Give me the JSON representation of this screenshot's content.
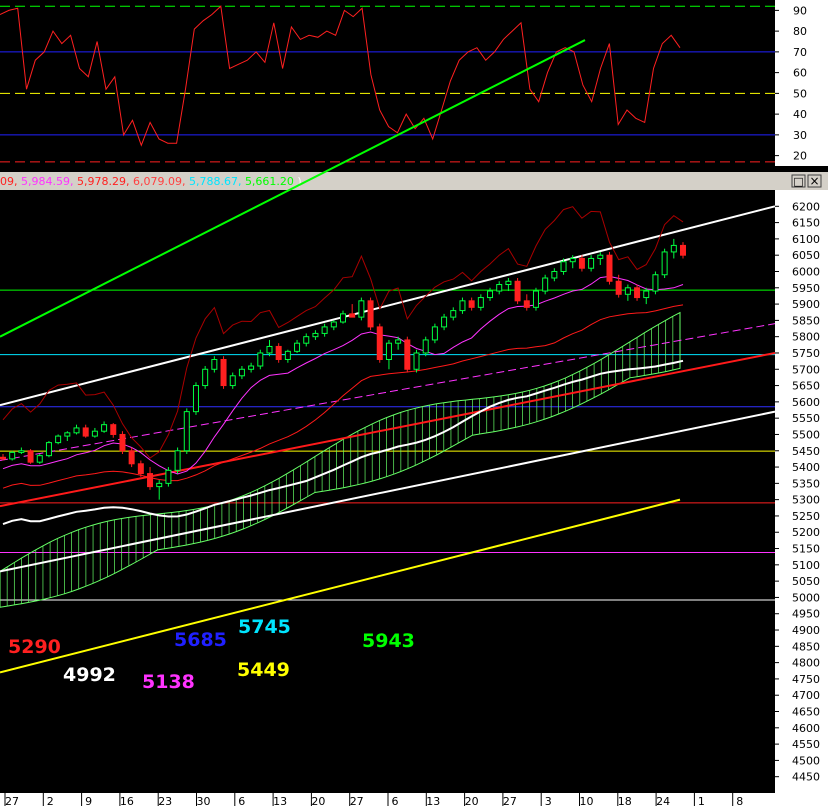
{
  "colors": {
    "background": "#000000",
    "axis_panel": "#ffffff",
    "title_bar": "#d4d0c8",
    "rsi": "#ff2020",
    "price_up": "#00ff40",
    "price_down": "#ff2020",
    "white_line": "#ffffff",
    "green_line": "#00ff00",
    "red_line": "#ff1a1a",
    "yellow_line": "#ffff00",
    "magenta_line": "#ff33ff",
    "cloud": "#66ff66"
  },
  "legend": {
    "values": [
      {
        "text": "09,",
        "color": "#ff2020"
      },
      {
        "text": "5,984.59,",
        "color": "#ff33ff"
      },
      {
        "text": "5,978.29,",
        "color": "#ff2020"
      },
      {
        "text": "6,079.09,",
        "color": "#ff4040"
      },
      {
        "text": "5,788.67,",
        "color": "#00e5ff"
      },
      {
        "text": "5,661.20",
        "color": "#00ff00"
      },
      {
        "text": ")",
        "color": "#ffffff"
      }
    ]
  },
  "window_buttons": {
    "restore": "□",
    "close": "×"
  },
  "chart_data": [
    {
      "type": "line",
      "panel": "rsi",
      "yticks": [
        20,
        30,
        40,
        50,
        60,
        70,
        80,
        90
      ],
      "ylim": [
        15,
        95
      ],
      "reference_lines": [
        {
          "value": 92,
          "color": "#00ff00",
          "style": "dashed"
        },
        {
          "value": 70,
          "color": "#2020ff",
          "style": "solid"
        },
        {
          "value": 50,
          "color": "#ffff00",
          "style": "dashed"
        },
        {
          "value": 30,
          "color": "#2020ff",
          "style": "solid"
        },
        {
          "value": 17,
          "color": "#ff2020",
          "style": "dashed"
        }
      ],
      "series": [
        {
          "values": [
            88,
            90,
            91,
            52,
            66,
            70,
            80,
            74,
            78,
            62,
            58,
            75,
            52,
            58,
            30,
            37,
            25,
            36,
            28,
            26,
            26,
            52,
            81,
            85,
            88,
            92,
            62,
            64,
            66,
            70,
            65,
            84,
            62,
            82,
            76,
            78,
            77,
            80,
            78,
            90,
            87,
            91,
            59,
            42,
            34,
            31,
            40,
            33,
            38,
            28,
            42,
            56,
            66,
            70,
            72,
            66,
            70,
            76,
            80,
            84,
            52,
            46,
            60,
            70,
            72,
            70,
            54,
            46,
            62,
            74,
            35,
            42,
            38,
            36,
            62,
            74,
            78,
            72
          ]
        }
      ]
    },
    {
      "type": "candlestick",
      "panel": "price",
      "x_tick_labels": [
        "27",
        "2",
        "9",
        "16",
        "23",
        "30",
        "6",
        "13",
        "20",
        "27",
        "6",
        "13",
        "20",
        "27",
        "3",
        "10",
        "18",
        "24",
        "1",
        "8"
      ],
      "yticks": [
        4450,
        4500,
        4550,
        4600,
        4650,
        4700,
        4750,
        4800,
        4850,
        4900,
        4950,
        5000,
        5050,
        5100,
        5150,
        5200,
        5250,
        5300,
        5350,
        5400,
        5450,
        5500,
        5550,
        5600,
        5650,
        5700,
        5750,
        5800,
        5850,
        5900,
        5950,
        6000,
        6050,
        6100,
        6150,
        6200
      ],
      "ylim": [
        4400,
        6250
      ],
      "horizontal_levels": [
        {
          "value": 5943,
          "color": "#00ff00"
        },
        {
          "value": 5745,
          "color": "#00e5ff"
        },
        {
          "value": 5585,
          "color": "#3030ff"
        },
        {
          "value": 5449,
          "color": "#ffff00"
        },
        {
          "value": 5290,
          "color": "#ff2020"
        },
        {
          "value": 5138,
          "color": "#ff33ff"
        },
        {
          "value": 4992,
          "color": "#ffffff"
        }
      ],
      "level_labels": [
        {
          "text": "5290",
          "color": "#ff2020"
        },
        {
          "text": "4992",
          "color": "#ffffff"
        },
        {
          "text": "5685",
          "color": "#2020ff"
        },
        {
          "text": "5138",
          "color": "#ff33ff"
        },
        {
          "text": "5745",
          "color": "#00e5ff"
        },
        {
          "text": "5449",
          "color": "#ffff00"
        },
        {
          "text": "5943",
          "color": "#00ff00"
        }
      ],
      "candles": [
        [
          5430,
          5440,
          5420,
          5425
        ],
        [
          5425,
          5450,
          5420,
          5445
        ],
        [
          5445,
          5460,
          5440,
          5450
        ],
        [
          5450,
          5455,
          5410,
          5415
        ],
        [
          5415,
          5440,
          5410,
          5435
        ],
        [
          5435,
          5480,
          5430,
          5475
        ],
        [
          5475,
          5500,
          5470,
          5495
        ],
        [
          5495,
          5510,
          5480,
          5505
        ],
        [
          5505,
          5530,
          5500,
          5520
        ],
        [
          5520,
          5530,
          5490,
          5495
        ],
        [
          5495,
          5520,
          5490,
          5510
        ],
        [
          5510,
          5540,
          5505,
          5530
        ],
        [
          5530,
          5535,
          5490,
          5500
        ],
        [
          5500,
          5510,
          5440,
          5450
        ],
        [
          5450,
          5460,
          5400,
          5410
        ],
        [
          5410,
          5420,
          5370,
          5380
        ],
        [
          5380,
          5400,
          5330,
          5340
        ],
        [
          5340,
          5360,
          5300,
          5350
        ],
        [
          5350,
          5400,
          5340,
          5390
        ],
        [
          5390,
          5460,
          5380,
          5450
        ],
        [
          5450,
          5580,
          5440,
          5570
        ],
        [
          5570,
          5660,
          5560,
          5650
        ],
        [
          5650,
          5710,
          5640,
          5700
        ],
        [
          5700,
          5740,
          5690,
          5730
        ],
        [
          5730,
          5740,
          5640,
          5650
        ],
        [
          5650,
          5690,
          5640,
          5680
        ],
        [
          5680,
          5710,
          5670,
          5700
        ],
        [
          5700,
          5720,
          5690,
          5710
        ],
        [
          5710,
          5760,
          5700,
          5750
        ],
        [
          5750,
          5790,
          5740,
          5770
        ],
        [
          5770,
          5780,
          5720,
          5730
        ],
        [
          5730,
          5760,
          5720,
          5755
        ],
        [
          5755,
          5790,
          5750,
          5780
        ],
        [
          5780,
          5810,
          5770,
          5800
        ],
        [
          5800,
          5820,
          5790,
          5810
        ],
        [
          5810,
          5840,
          5800,
          5830
        ],
        [
          5830,
          5850,
          5820,
          5845
        ],
        [
          5845,
          5880,
          5840,
          5870
        ],
        [
          5870,
          5900,
          5860,
          5860
        ],
        [
          5860,
          5920,
          5850,
          5910
        ],
        [
          5910,
          5920,
          5820,
          5830
        ],
        [
          5830,
          5840,
          5720,
          5730
        ],
        [
          5730,
          5790,
          5700,
          5780
        ],
        [
          5780,
          5800,
          5760,
          5790
        ],
        [
          5790,
          5800,
          5690,
          5700
        ],
        [
          5700,
          5760,
          5690,
          5750
        ],
        [
          5750,
          5800,
          5740,
          5790
        ],
        [
          5790,
          5840,
          5780,
          5830
        ],
        [
          5830,
          5870,
          5820,
          5860
        ],
        [
          5860,
          5890,
          5850,
          5880
        ],
        [
          5880,
          5920,
          5870,
          5910
        ],
        [
          5910,
          5920,
          5880,
          5890
        ],
        [
          5890,
          5930,
          5880,
          5920
        ],
        [
          5920,
          5950,
          5910,
          5940
        ],
        [
          5940,
          5970,
          5930,
          5960
        ],
        [
          5960,
          5980,
          5940,
          5970
        ],
        [
          5970,
          5980,
          5900,
          5910
        ],
        [
          5910,
          5930,
          5880,
          5890
        ],
        [
          5890,
          5950,
          5880,
          5940
        ],
        [
          5940,
          5990,
          5930,
          5980
        ],
        [
          5980,
          6010,
          5970,
          6000
        ],
        [
          6000,
          6040,
          5990,
          6030
        ],
        [
          6030,
          6050,
          6010,
          6040
        ],
        [
          6040,
          6050,
          6000,
          6010
        ],
        [
          6010,
          6050,
          6000,
          6040
        ],
        [
          6040,
          6060,
          6020,
          6050
        ],
        [
          6050,
          6060,
          5960,
          5970
        ],
        [
          5970,
          5990,
          5920,
          5930
        ],
        [
          5930,
          5960,
          5910,
          5950
        ],
        [
          5950,
          5960,
          5910,
          5920
        ],
        [
          5920,
          5950,
          5900,
          5940
        ],
        [
          5940,
          6000,
          5930,
          5990
        ],
        [
          5990,
          6070,
          5980,
          6060
        ],
        [
          6060,
          6100,
          6040,
          6080
        ],
        [
          6080,
          6090,
          6040,
          6050
        ]
      ]
    }
  ]
}
